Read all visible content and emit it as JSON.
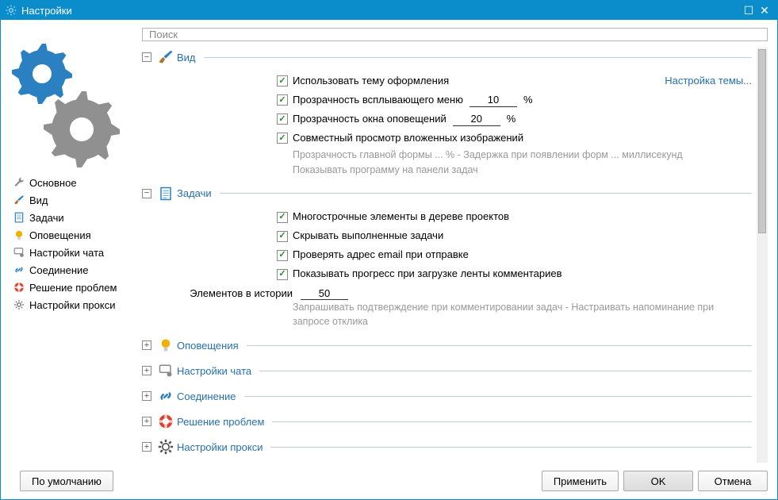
{
  "window": {
    "title": "Настройки"
  },
  "search": {
    "placeholder": "Поиск"
  },
  "nav": {
    "items": [
      {
        "label": "Основное"
      },
      {
        "label": "Вид"
      },
      {
        "label": "Задачи"
      },
      {
        "label": "Оповещения"
      },
      {
        "label": "Настройки чата"
      },
      {
        "label": "Соединение"
      },
      {
        "label": "Решение проблем"
      },
      {
        "label": "Настройки прокси"
      }
    ]
  },
  "groups": {
    "view": {
      "title": "Вид",
      "items": {
        "use_theme": "Использовать тему оформления",
        "theme_link": "Настройка темы...",
        "menu_opacity": "Прозрачность всплывающего меню",
        "menu_opacity_val": "10",
        "pct": "%",
        "notif_opacity": "Прозрачность окна оповещений",
        "notif_opacity_val": "20",
        "shared_view": "Совместный просмотр вложенных изображений",
        "hint1": "Прозрачность главной формы ... % -  Задержка при появлении форм ... миллисекунд",
        "hint2": "Показывать программу на панели задач"
      }
    },
    "tasks": {
      "title": "Задачи",
      "items": {
        "multiline": "Многострочные элементы в дереве проектов",
        "hide_done": "Скрывать выполненные задачи",
        "check_email": "Проверять адрес email при отправке",
        "show_progress": "Показывать прогресс при загрузке ленты комментариев",
        "history_label": "Элементов в истории",
        "history_val": "50",
        "hint": "Запрашивать подтверждение при комментировании задач -  Настраивать напоминание при запросе отклика"
      }
    },
    "collapsed": {
      "notifications": "Оповещения",
      "chat": "Настройки чата",
      "connection": "Соединение",
      "troubleshoot": "Решение проблем",
      "proxy": "Настройки прокси"
    }
  },
  "footer": {
    "defaults": "По умолчанию",
    "apply": "Применить",
    "ok": "OK",
    "cancel": "Отмена"
  }
}
